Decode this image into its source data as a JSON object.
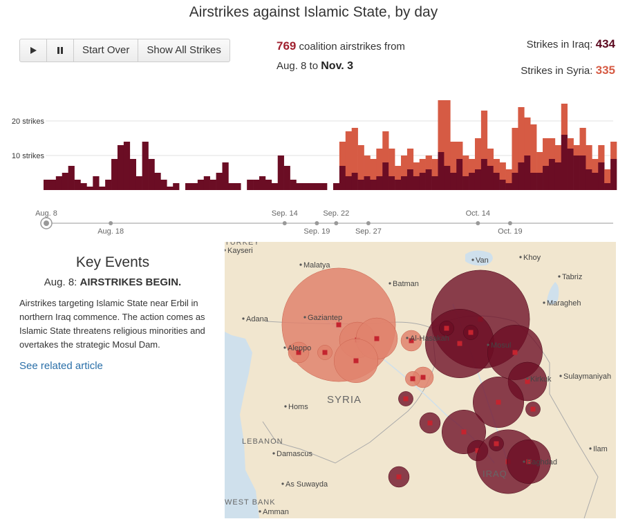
{
  "title": "Airstrikes against Islamic State, by day",
  "controls": {
    "play_icon": "play-icon",
    "pause_icon": "pause-icon",
    "start_over": "Start Over",
    "show_all": "Show All Strikes"
  },
  "summary": {
    "total": "769",
    "text1": "coalition airstrikes from",
    "from": "Aug. 8",
    "to_word": "to",
    "to": "Nov. 3"
  },
  "counts": {
    "iraq_label": "Strikes in Iraq:",
    "iraq_value": "434",
    "syria_label": "Strikes in Syria:",
    "syria_value": "335"
  },
  "colors": {
    "iraq": "#6b0d24",
    "syria": "#d65b44",
    "syria_bubble": "#e0826d",
    "marker": "#c4242f",
    "land": "#f1e6cf",
    "water": "#cfe0ec",
    "link": "#2a6fa8"
  },
  "chart_data": {
    "type": "bar",
    "stacked": true,
    "title": "Airstrikes against Islamic State, by day",
    "y_tick_labels": [
      "10 strikes",
      "20 strikes"
    ],
    "y_ticks": [
      10,
      20
    ],
    "ylim": [
      0,
      26
    ],
    "grid": true,
    "x_start": "Aug. 8",
    "x_end": "Nov. 3",
    "x_tick_labels_top": [
      "Aug. 8",
      "Sep. 14",
      "Sep. 22",
      "Oct. 14"
    ],
    "x_tick_labels_bottom": [
      "Aug. 18",
      "Sep. 19",
      "Sep. 27",
      "Oct. 19"
    ],
    "series": [
      {
        "name": "Strikes in Iraq",
        "values": [
          3,
          3,
          4,
          5,
          7,
          3,
          2,
          1,
          4,
          1,
          3,
          9,
          13,
          14,
          9,
          4,
          14,
          9,
          5,
          3,
          1,
          2,
          0,
          2,
          2,
          3,
          4,
          3,
          5,
          8,
          2,
          2,
          0,
          3,
          3,
          4,
          3,
          2,
          10,
          7,
          3,
          2,
          2,
          2,
          2,
          2,
          0,
          2,
          7,
          4,
          5,
          3,
          4,
          3,
          4,
          8,
          4,
          3,
          4,
          6,
          4,
          5,
          6,
          4,
          11,
          7,
          5,
          9,
          4,
          5,
          6,
          9,
          7,
          5,
          3,
          2,
          5,
          8,
          10,
          5,
          5,
          7,
          9,
          8,
          16,
          12,
          10,
          10,
          6,
          5,
          8,
          2,
          9
        ]
      },
      {
        "name": "Strikes in Syria",
        "values": [
          0,
          0,
          0,
          0,
          0,
          0,
          0,
          0,
          0,
          0,
          0,
          0,
          0,
          0,
          0,
          0,
          0,
          0,
          0,
          0,
          0,
          0,
          0,
          0,
          0,
          0,
          0,
          0,
          0,
          0,
          0,
          0,
          0,
          0,
          0,
          0,
          0,
          0,
          0,
          0,
          0,
          0,
          0,
          0,
          0,
          0,
          0,
          0,
          0,
          0,
          0,
          0,
          0,
          0,
          0,
          0,
          0,
          0,
          0,
          0,
          0,
          0,
          0,
          0,
          0,
          0,
          0,
          0,
          0,
          0,
          0,
          0,
          0,
          0,
          0,
          0,
          0,
          0,
          0,
          0,
          0,
          0,
          0,
          0,
          0,
          0,
          0,
          0,
          0,
          0,
          0,
          0,
          0
        ]
      }
    ],
    "syria_values": [
      0,
      0,
      0,
      0,
      0,
      0,
      0,
      0,
      0,
      0,
      0,
      0,
      0,
      0,
      0,
      0,
      0,
      0,
      0,
      0,
      0,
      0,
      0,
      0,
      0,
      0,
      0,
      0,
      0,
      0,
      0,
      0,
      0,
      0,
      0,
      0,
      0,
      0,
      0,
      0,
      0,
      0,
      0,
      0,
      0,
      0,
      0,
      0,
      7,
      13,
      13,
      10,
      6,
      6,
      8,
      9,
      8,
      4,
      6,
      6,
      4,
      4,
      4,
      5,
      15,
      19,
      9,
      5,
      6,
      4,
      9,
      14,
      5,
      4,
      5,
      4,
      13,
      16,
      11,
      14,
      6,
      8,
      6,
      5,
      9,
      3,
      3,
      8,
      7,
      4,
      5,
      4,
      5
    ]
  },
  "timeline": {
    "top_labels": [
      {
        "label": "Aug. 8",
        "day": 0
      },
      {
        "label": "Sep. 14",
        "day": 37
      },
      {
        "label": "Sep. 22",
        "day": 45
      },
      {
        "label": "Oct. 14",
        "day": 67
      }
    ],
    "bottom_labels": [
      {
        "label": "Aug. 18",
        "day": 10
      },
      {
        "label": "Sep. 19",
        "day": 42
      },
      {
        "label": "Sep. 27",
        "day": 50
      },
      {
        "label": "Oct. 19",
        "day": 72
      }
    ],
    "total_days": 88
  },
  "events": {
    "heading": "Key Events",
    "date": "Aug. 8:",
    "headline": "AIRSTRIKES BEGIN.",
    "body": "Airstrikes targeting Islamic State near Erbil in northern Iraq commence. The action comes as Islamic State threatens religious minorities and overtakes the strategic Mosul Dam.",
    "link": "See related article"
  },
  "map": {
    "cities": [
      {
        "name": "Malatya"
      },
      {
        "name": "Batman"
      },
      {
        "name": "Van"
      },
      {
        "name": "Khoy"
      },
      {
        "name": "Tabriz"
      },
      {
        "name": "Maragheh"
      },
      {
        "name": "Adana"
      },
      {
        "name": "Gaziantep"
      },
      {
        "name": "Aleppo"
      },
      {
        "name": "Al-Hasakah"
      },
      {
        "name": "Mosul"
      },
      {
        "name": "Kirkuk"
      },
      {
        "name": "Sulaymaniyah"
      },
      {
        "name": "Homs"
      },
      {
        "name": "Damascus"
      },
      {
        "name": "As Suwayda"
      },
      {
        "name": "Amman"
      },
      {
        "name": "Baghdad"
      },
      {
        "name": "Ilam"
      },
      {
        "name": "Kayseri"
      }
    ],
    "countries": [
      "SYRIA",
      "IRAQ",
      "LEBANON",
      "WEST BANK",
      "TURKEY"
    ],
    "strike_sites": [
      {
        "country": "Syria",
        "strikes": 60
      },
      {
        "country": "Syria",
        "strikes": 6
      },
      {
        "country": "Syria",
        "strikes": 1
      },
      {
        "country": "Syria",
        "strikes": 2
      },
      {
        "country": "Syria",
        "strikes": 2
      },
      {
        "country": "Syria",
        "strikes": 8
      },
      {
        "country": "Syria",
        "strikes": 9
      },
      {
        "country": "Syria",
        "strikes": 2
      },
      {
        "country": "Syria",
        "strikes": 1
      },
      {
        "country": "Iraq",
        "strikes": 2
      },
      {
        "country": "Iraq",
        "strikes": 45
      },
      {
        "country": "Iraq",
        "strikes": 22
      },
      {
        "country": "Iraq",
        "strikes": 14
      },
      {
        "country": "Iraq",
        "strikes": 7
      },
      {
        "country": "Iraq",
        "strikes": 12
      },
      {
        "country": "Iraq",
        "strikes": 1
      },
      {
        "country": "Iraq",
        "strikes": 9
      },
      {
        "country": "Iraq",
        "strikes": 2
      },
      {
        "country": "Iraq",
        "strikes": 19
      },
      {
        "country": "Iraq",
        "strikes": 9
      },
      {
        "country": "Iraq",
        "strikes": 2
      },
      {
        "country": "Iraq",
        "strikes": 1
      },
      {
        "country": "Iraq",
        "strikes": 1
      },
      {
        "country": "Iraq",
        "strikes": 1
      },
      {
        "country": "Iraq",
        "strikes": 1
      }
    ]
  }
}
